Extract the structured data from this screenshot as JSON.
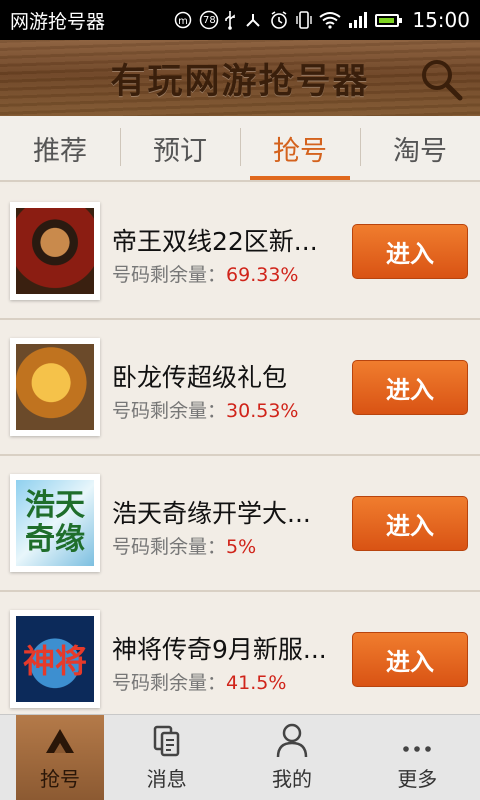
{
  "status_bar": {
    "app_name": "网游抢号器",
    "time": "15:00",
    "notif_count": "78"
  },
  "header": {
    "title": "有玩网游抢号器"
  },
  "tabs": [
    {
      "label": "推荐"
    },
    {
      "label": "预订"
    },
    {
      "label": "抢号",
      "active": true
    },
    {
      "label": "淘号"
    }
  ],
  "list": {
    "remaining_label": "号码剩余量：",
    "button_label": "进入",
    "items": [
      {
        "name": "帝王双线22区新...",
        "remaining": "69.33%",
        "icon": "emperor-game-icon"
      },
      {
        "name": "卧龙传超级礼包",
        "remaining": "30.53%",
        "icon": "dragon-game-icon"
      },
      {
        "name": "浩天奇缘开学大...",
        "remaining": "5%",
        "icon": "haotian-game-icon",
        "logo_text": "浩天奇缘"
      },
      {
        "name": "神将传奇9月新服...",
        "remaining": "41.5%",
        "icon": "shenjiang-game-icon",
        "logo_text": "神将"
      }
    ]
  },
  "bottom_nav": [
    {
      "label": "抢号",
      "icon": "horn-icon",
      "active": true
    },
    {
      "label": "消息",
      "icon": "message-icon"
    },
    {
      "label": "我的",
      "icon": "user-icon"
    },
    {
      "label": "更多",
      "icon": "more-icon"
    }
  ],
  "colors": {
    "accent": "#e0681d",
    "button": "#e06020",
    "percent": "#d0241a"
  }
}
